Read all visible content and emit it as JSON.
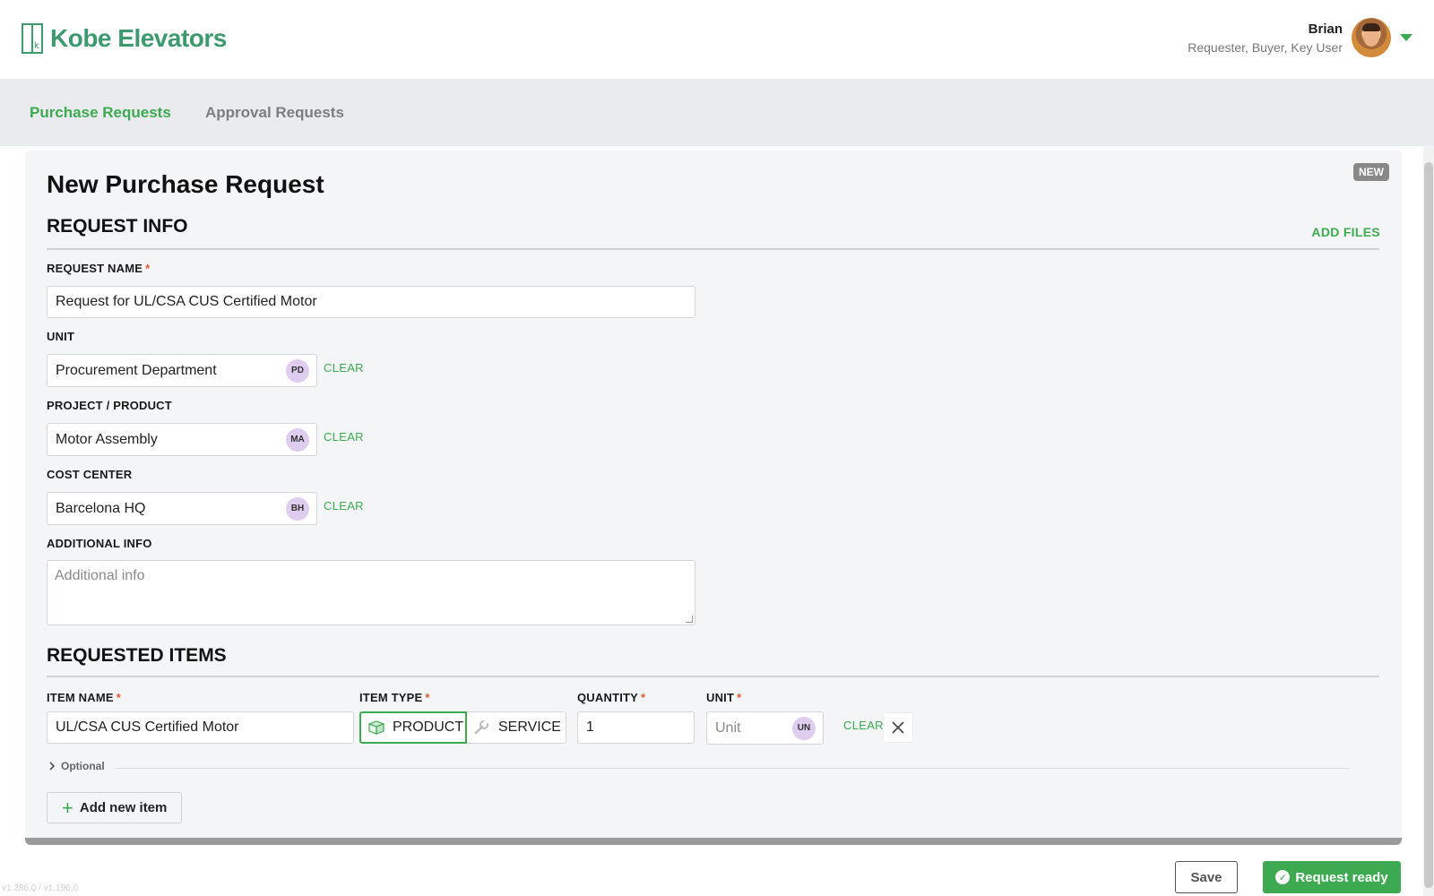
{
  "header": {
    "logo_text": "Kobe Elevators",
    "user_name": "Brian",
    "user_roles": "Requester, Buyer, Key User"
  },
  "nav": {
    "tabs": [
      {
        "label": "Purchase Requests",
        "active": true
      },
      {
        "label": "Approval Requests",
        "active": false
      }
    ]
  },
  "form": {
    "title": "New Purchase Request",
    "badge": "NEW",
    "request_info": {
      "section_title": "REQUEST INFO",
      "add_files_label": "ADD FILES",
      "request_name": {
        "label": "REQUEST NAME",
        "value": "Request for UL/CSA CUS Certified Motor"
      },
      "unit": {
        "label": "UNIT",
        "value": "Procurement Department",
        "chip": "PD"
      },
      "project": {
        "label": "PROJECT / PRODUCT",
        "value": "Motor Assembly",
        "chip": "MA"
      },
      "cost_center": {
        "label": "COST CENTER",
        "value": "Barcelona HQ",
        "chip": "BH"
      },
      "additional_info": {
        "label": "ADDITIONAL INFO",
        "placeholder": "Additional info"
      },
      "clear_label": "CLEAR",
      "required_mark": "*"
    },
    "requested_items": {
      "section_title": "REQUESTED ITEMS",
      "item_name_label": "ITEM NAME",
      "item_type_label": "ITEM TYPE",
      "quantity_label": "QUANTITY",
      "unit_label": "UNIT",
      "item": {
        "name": "UL/CSA CUS Certified Motor",
        "type_options": [
          "PRODUCT",
          "SERVICE"
        ],
        "selected_type": "PRODUCT",
        "quantity": "1",
        "unit_placeholder": "Unit",
        "unit_chip": "UN"
      },
      "clear_label": "CLEAR",
      "optional_label": "Optional",
      "add_item_label": "Add new item"
    }
  },
  "footer": {
    "save_label": "Save",
    "ready_label": "Request ready",
    "version": "v1.286.0 / v1.196.0"
  },
  "colors": {
    "brand_green": "#3daa52",
    "logo_green": "#3d9a6e",
    "required_red": "#e05a2b",
    "chip_purple": "#dfcdf0"
  },
  "icons": [
    "elevator-logo-icon",
    "chevron-down-icon",
    "box-icon",
    "wrench-icon",
    "close-icon",
    "chevron-right-icon",
    "plus-icon",
    "check-circle-icon"
  ]
}
